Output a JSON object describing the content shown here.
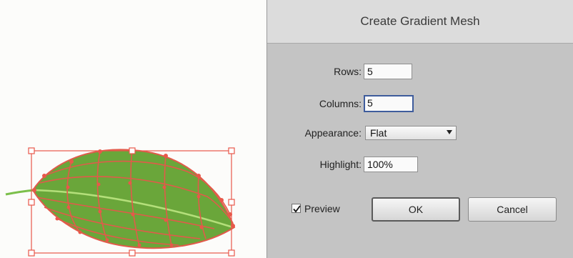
{
  "dialog": {
    "title": "Create Gradient Mesh",
    "rows": {
      "label": "Rows:",
      "value": "5"
    },
    "columns": {
      "label": "Columns:",
      "value": "5"
    },
    "appearance": {
      "label": "Appearance:",
      "value": "Flat"
    },
    "highlight": {
      "label": "Highlight:",
      "value": "100%"
    },
    "preview": {
      "label": "Preview",
      "checked": true
    },
    "ok_label": "OK",
    "cancel_label": "Cancel"
  },
  "colors": {
    "leaf_fill": "#6aa63a",
    "mesh_line": "#e25a4a",
    "selection": "#e8584a",
    "focus_border": "#3e5c9c"
  }
}
